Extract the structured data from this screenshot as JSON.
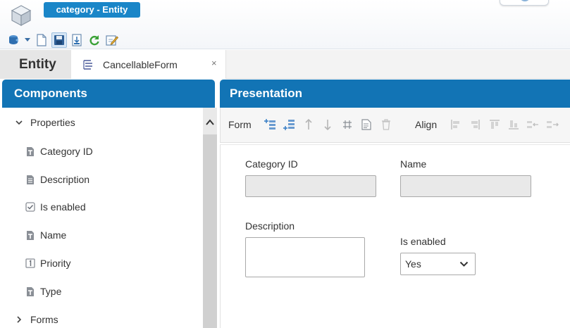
{
  "window": {
    "title": "category - Entity"
  },
  "toolbar": {
    "icons": [
      "database-icon",
      "new-document-icon",
      "save-icon",
      "export-icon",
      "refresh-icon",
      "edit-icon"
    ]
  },
  "tabs": {
    "entity_label": "Entity",
    "form_tab_label": "CancellableForm",
    "close_glyph": "×"
  },
  "components": {
    "title": "Components",
    "properties_label": "Properties",
    "items": [
      {
        "label": "Category ID",
        "icon": "text-field-icon"
      },
      {
        "label": "Description",
        "icon": "document-field-icon"
      },
      {
        "label": "Is enabled",
        "icon": "checkbox-field-icon"
      },
      {
        "label": "Name",
        "icon": "text-field-icon"
      },
      {
        "label": "Priority",
        "icon": "number-field-icon"
      },
      {
        "label": "Type",
        "icon": "text-field-icon"
      }
    ],
    "forms_label": "Forms"
  },
  "presentation": {
    "title": "Presentation",
    "form_label": "Form",
    "align_label": "Align"
  },
  "form": {
    "category_id_label": "Category ID",
    "category_id_value": "",
    "name_label": "Name",
    "name_value": "",
    "description_label": "Description",
    "description_value": "",
    "is_enabled_label": "Is enabled",
    "is_enabled_value": "Yes"
  },
  "colors": {
    "header_blue": "#1274b5",
    "title_pill_blue": "#1a86c8"
  }
}
